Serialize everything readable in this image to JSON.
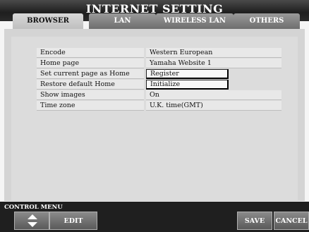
{
  "title": "INTERNET SETTING",
  "tabs": [
    {
      "label": "BROWSER",
      "active": true
    },
    {
      "label": "LAN",
      "active": false
    },
    {
      "label": "WIRELESS LAN",
      "active": false
    },
    {
      "label": "OTHERS",
      "active": false
    }
  ],
  "settings": [
    {
      "label": "Encode",
      "value": "Western European",
      "type": "value"
    },
    {
      "label": "Home page",
      "value": "Yamaha Website 1",
      "type": "value"
    },
    {
      "label": "Set current page as Home",
      "value": "Register",
      "type": "button"
    },
    {
      "label": "Restore default Home",
      "value": "Initialize",
      "type": "button"
    },
    {
      "label": "Show images",
      "value": "On",
      "type": "value"
    },
    {
      "label": "Time zone",
      "value": "U.K. time(GMT)",
      "type": "value"
    }
  ],
  "control_menu": {
    "label": "CONTROL MENU",
    "arrows_icon": "up-down-arrows-icon",
    "edit": "EDIT",
    "save": "SAVE",
    "cancel": "CANCEL"
  }
}
